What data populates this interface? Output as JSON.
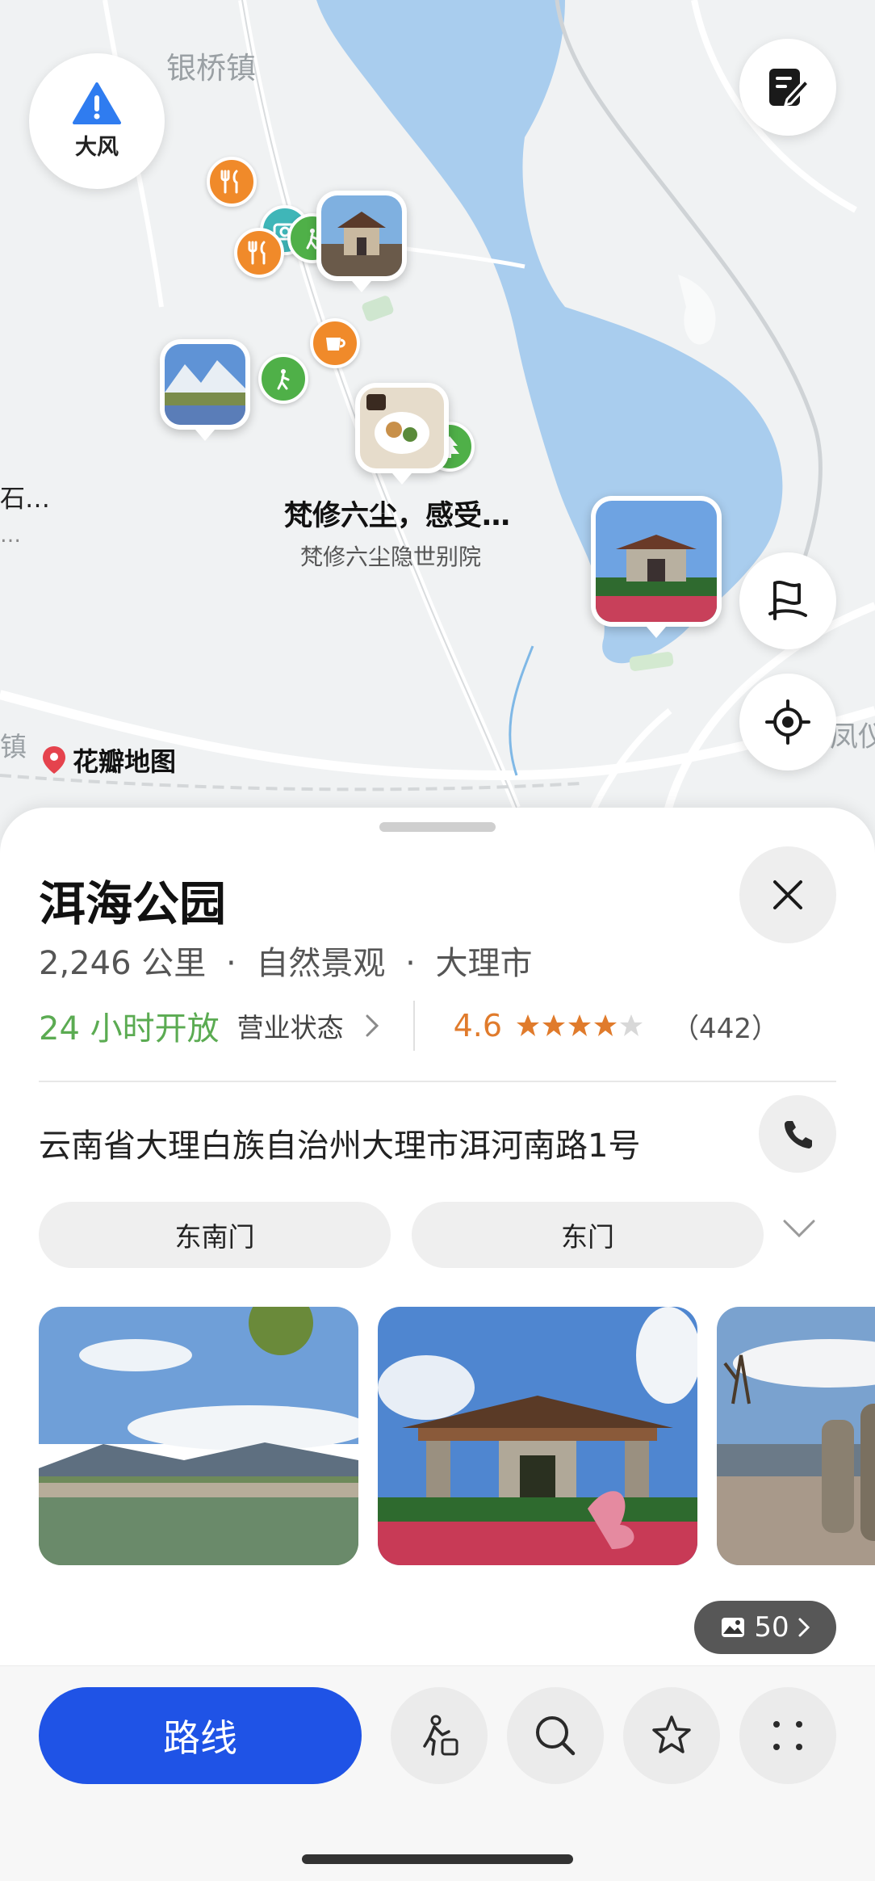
{
  "map": {
    "town_labels": [
      "银桥镇",
      "凤仪",
      "镇",
      "石…",
      "…"
    ],
    "weather": {
      "label": "大风",
      "icon": "warning-icon"
    },
    "note_icon": "edit-icon",
    "flag_icon": "flag-icon",
    "locate_icon": "locate-icon",
    "callout": {
      "title": "梵修六尘，感受…",
      "subtitle": "梵修六尘隐世别院"
    },
    "brand": "花瓣地图",
    "colors": {
      "water": "#a9cdee",
      "land": "#f0f2f3",
      "road": "#ffffff"
    }
  },
  "place": {
    "name": "洱海公园",
    "distance": "2,246 公里",
    "category": "自然景观",
    "city": "大理市",
    "sep": "·",
    "open_status": "24 小时开放",
    "business_label": "营业状态",
    "rating": "4.6",
    "stars": 4.5,
    "review_count": "（442）",
    "address": "云南省大理白族自治州大理市洱河南路1号",
    "gates": [
      "东南门",
      "东门"
    ],
    "photo_count": "50"
  },
  "actions": {
    "route_label": "路线",
    "icons": [
      "person-walking-icon",
      "search-icon",
      "star-icon",
      "more-icon"
    ]
  },
  "colors": {
    "accent_blue": "#1f53e6",
    "open_green": "#5bab52",
    "rating_orange": "#e07b2c"
  }
}
